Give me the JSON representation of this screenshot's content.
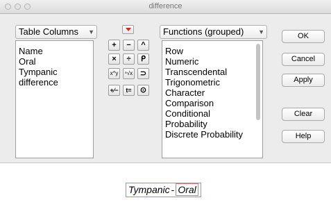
{
  "window": {
    "title": "difference"
  },
  "table_columns": {
    "header": "Table Columns",
    "items": [
      "Name",
      "Oral",
      "Tympanic",
      "difference"
    ]
  },
  "keypad": {
    "keys": [
      "+",
      "−",
      "^",
      "×",
      "÷",
      "ᑭ",
      "x^y",
      "ⁿ√x",
      "⊃",
      "+∕−",
      "t=",
      "⊙"
    ]
  },
  "functions": {
    "header": "Functions (grouped)",
    "items": [
      "Row",
      "Numeric",
      "Transcendental",
      "Trigonometric",
      "Character",
      "Comparison",
      "Conditional",
      "Probability",
      "Discrete Probability"
    ]
  },
  "buttons": {
    "ok": "OK",
    "cancel": "Cancel",
    "apply": "Apply",
    "clear": "Clear",
    "help": "Help"
  },
  "formula": {
    "left": "Tympanic",
    "operator": "-",
    "right": "Oral"
  },
  "colors": {
    "accent_red": "#d22222",
    "formula_border": "#e07a7a"
  }
}
